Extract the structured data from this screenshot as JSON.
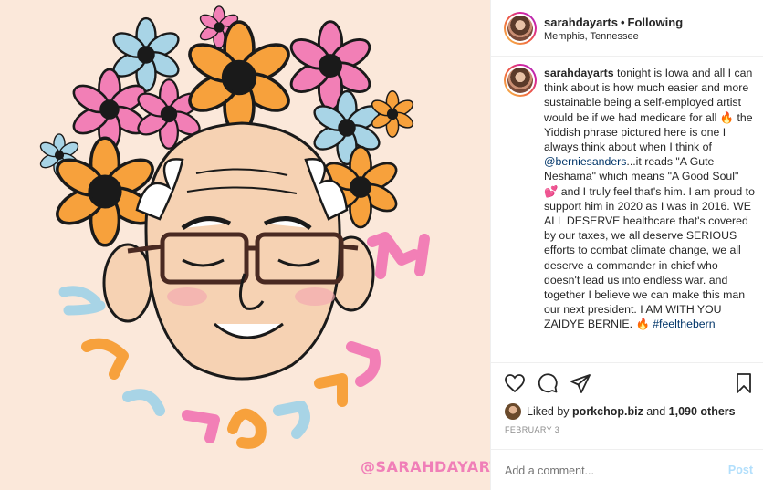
{
  "artwork": {
    "description_alt": "",
    "lettering": "רוט טוג א",
    "watermark": "@SARAHDAYARTS"
  },
  "header": {
    "username": "sarahdayarts",
    "separator": "•",
    "follow_label": "Following",
    "location": "Memphis, Tennessee"
  },
  "caption": {
    "username": "sarahdayarts",
    "part1": " tonight is Iowa and all I can think about is how much easier and more sustainable being a self-employed artist would be if we had medicare for all ",
    "emoji1": "🔥",
    "part2": " the Yiddish phrase pictured here is one I always think about when I think of ",
    "mention": "@berniesanders",
    "part3": "...it reads \"A Gute Neshama\" which means \"A Good Soul\" ",
    "emoji2": "💕",
    "part4": " and I truly feel that's him. I am proud to support him in 2020 as I was in 2016. WE ALL DESERVE healthcare that's covered by our taxes, we all deserve SERIOUS efforts to combat climate change, we all deserve a commander in chief who doesn't lead us into endless war. and together I believe we can make this man our next president. I AM WITH YOU ZAIDYE BERNIE. ",
    "emoji3": "🔥",
    "hashtag": "#feelthebern"
  },
  "actions": {
    "icons": [
      "heart-icon",
      "comment-icon",
      "share-icon",
      "bookmark-icon"
    ]
  },
  "likes": {
    "prefix": "Liked by ",
    "user": "porkchop.biz",
    "middle": " and ",
    "count": "1,090 others"
  },
  "date": "FEBRUARY 3",
  "comment": {
    "placeholder": "Add a comment...",
    "post_label": "Post"
  },
  "colors": {
    "story_ring": "#d6249f",
    "mention": "#003569",
    "post_disabled": "#b2dffc",
    "art_background": "#fbe8da"
  }
}
